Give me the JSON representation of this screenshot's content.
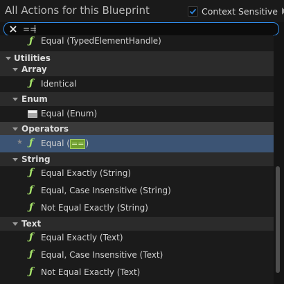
{
  "header": {
    "title": "All Actions for this Blueprint",
    "context_sensitive_label": "Context Sensitive",
    "context_sensitive_checked": true
  },
  "search": {
    "value": "==",
    "icon": "close-icon"
  },
  "list": {
    "item_top": "Equal (TypedElementHandle)",
    "cat_utilities": "Utilities",
    "cat_array": "Array",
    "array_identical": "Identical",
    "cat_enum": "Enum",
    "enum_equal": "Equal (Enum)",
    "cat_operators": "Operators",
    "operators_equal_prefix": "Equal (",
    "operators_equal_match": "==",
    "operators_equal_suffix": ")",
    "cat_string": "String",
    "string_equal_exactly": "Equal Exactly (String)",
    "string_case_insensitive": "Equal, Case Insensitive (String)",
    "string_not_equal": "Not Equal Exactly (String)",
    "cat_text": "Text",
    "text_equal_exactly": "Equal Exactly (Text)",
    "text_case_insensitive": "Equal, Case Insensitive (Text)",
    "text_not_equal": "Not Equal Exactly (Text)"
  },
  "colors": {
    "selection": "#3c5474",
    "search_border": "#2f8be8",
    "function_icon": "#a6e36a",
    "match_highlight": "#6f9e2f"
  }
}
